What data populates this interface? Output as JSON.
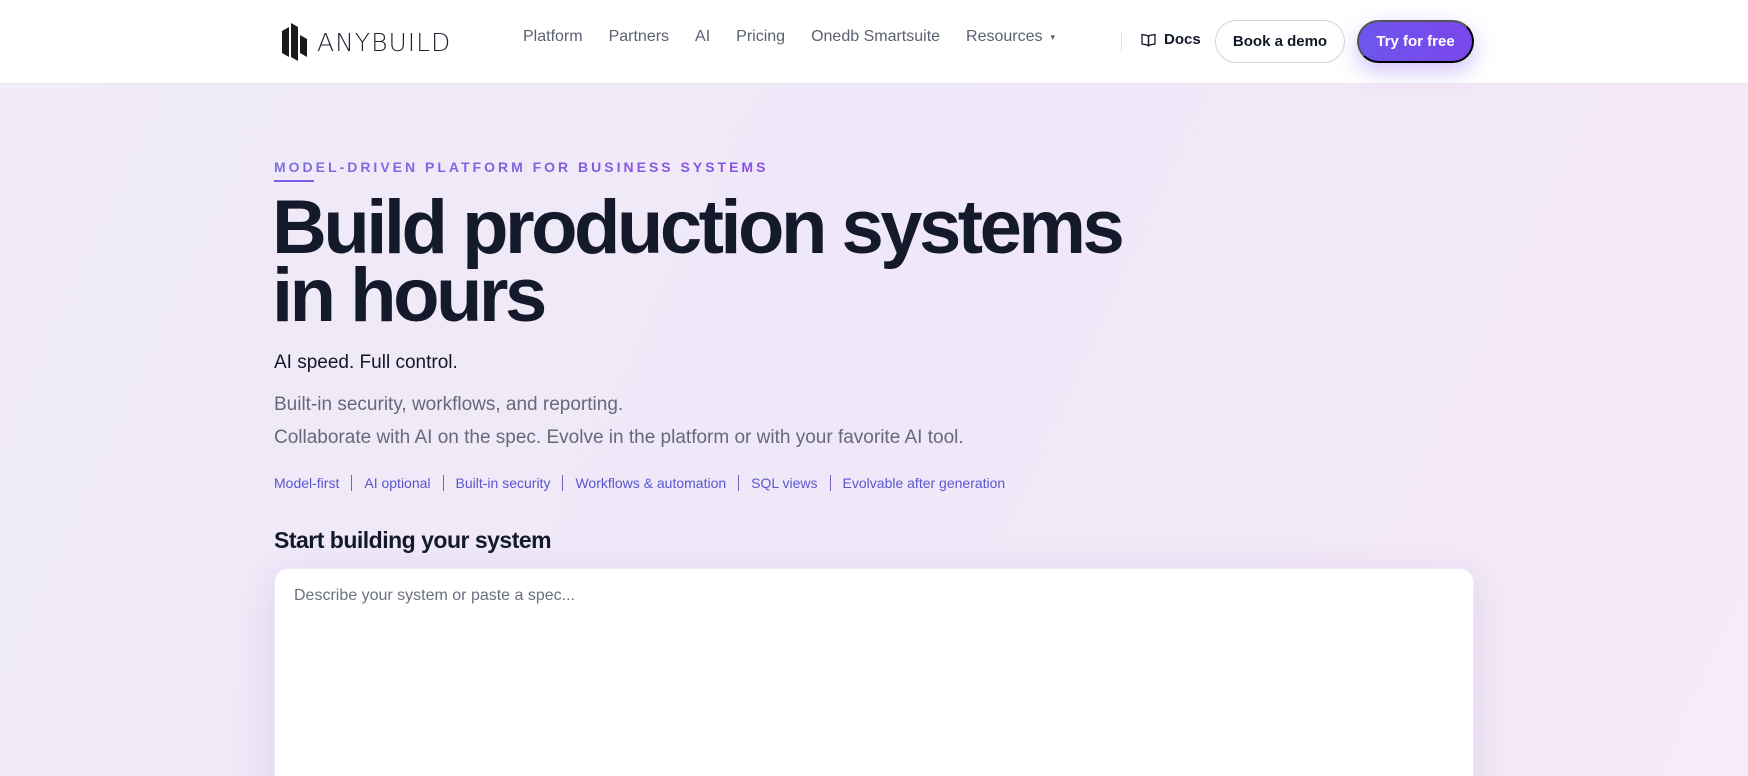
{
  "header": {
    "logo_text": "ANYBUILD",
    "logo_icon": "anybuild-logo-mark",
    "nav": [
      {
        "label": "Platform"
      },
      {
        "label": "Partners"
      },
      {
        "label": "AI"
      },
      {
        "label": "Pricing"
      },
      {
        "label": "Onedb Smartsuite"
      },
      {
        "label": "Resources",
        "has_dropdown": true,
        "caret": "▾"
      }
    ],
    "docs_label": "Docs",
    "docs_icon": "book-icon",
    "demo_label": "Book a demo",
    "try_label": "Try for free"
  },
  "hero": {
    "eyebrow": "MODEL-DRIVEN PLATFORM FOR BUSINESS SYSTEMS",
    "headline_line1": "Build production systems",
    "headline_line2": "in hours",
    "tagline": "AI speed. Full control.",
    "desc_line1": "Built-in security, workflows, and reporting.",
    "desc_line2": "Collaborate with AI on the spec. Evolve in the platform or with your favorite AI tool.",
    "features": [
      "Model-first",
      "AI optional",
      "Built-in security",
      "Workflows & automation",
      "SQL views",
      "Evolvable after generation"
    ]
  },
  "builder": {
    "title": "Start building your system",
    "value": "",
    "placeholder": "Describe your system or paste a spec..."
  },
  "colors": {
    "accent_start": "#6f55ee",
    "accent_end": "#7a47ea",
    "feature_link": "#5a55cf",
    "headline": "#141a2c"
  }
}
